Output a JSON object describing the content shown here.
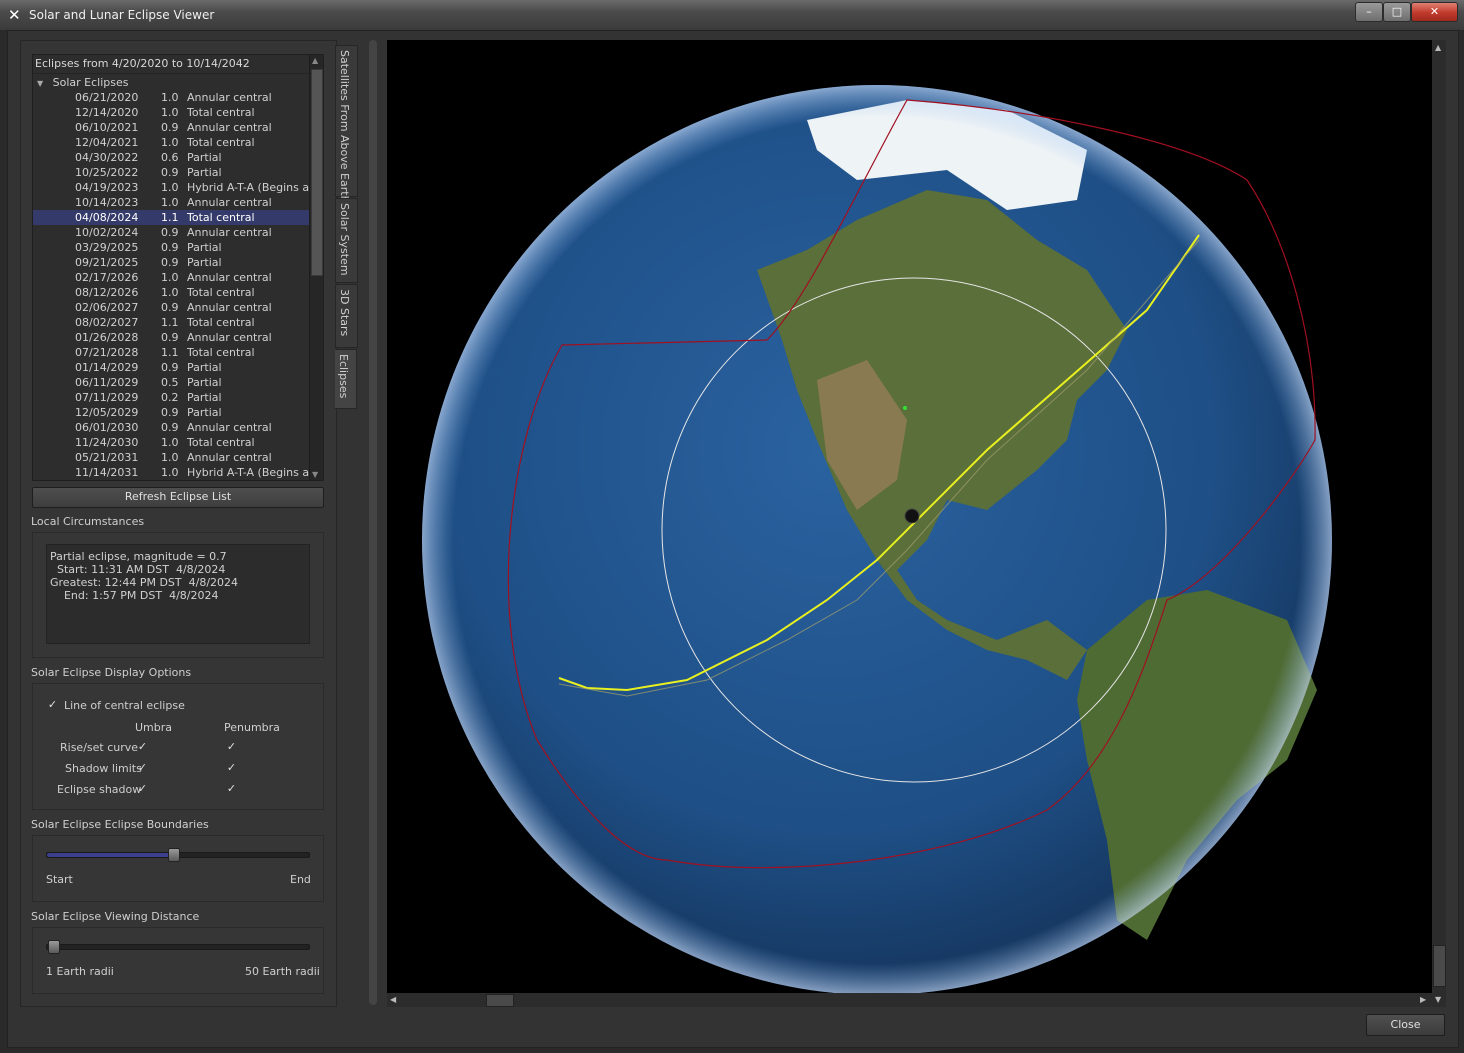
{
  "window": {
    "title": "Solar and Lunar Eclipse Viewer",
    "app_icon": "✕",
    "controls": {
      "minimize": "–",
      "maximize": "□",
      "close": "✕"
    }
  },
  "eclipse_list": {
    "header": "Eclipses from 4/20/2020 to 10/14/2042",
    "group_label": "Solar Eclipses",
    "rows": [
      {
        "date": "06/21/2020",
        "mag": "1.0",
        "type": "Annular central"
      },
      {
        "date": "12/14/2020",
        "mag": "1.0",
        "type": "Total central"
      },
      {
        "date": "06/10/2021",
        "mag": "0.9",
        "type": "Annular central"
      },
      {
        "date": "12/04/2021",
        "mag": "1.0",
        "type": "Total central"
      },
      {
        "date": "04/30/2022",
        "mag": "0.6",
        "type": "Partial"
      },
      {
        "date": "10/25/2022",
        "mag": "0.9",
        "type": "Partial"
      },
      {
        "date": "04/19/2023",
        "mag": "1.0",
        "type": "Hybrid A-T-A (Begins an..."
      },
      {
        "date": "10/14/2023",
        "mag": "1.0",
        "type": "Annular central"
      },
      {
        "date": "04/08/2024",
        "mag": "1.1",
        "type": "Total central"
      },
      {
        "date": "10/02/2024",
        "mag": "0.9",
        "type": "Annular central"
      },
      {
        "date": "03/29/2025",
        "mag": "0.9",
        "type": "Partial"
      },
      {
        "date": "09/21/2025",
        "mag": "0.9",
        "type": "Partial"
      },
      {
        "date": "02/17/2026",
        "mag": "1.0",
        "type": "Annular central"
      },
      {
        "date": "08/12/2026",
        "mag": "1.0",
        "type": "Total central"
      },
      {
        "date": "02/06/2027",
        "mag": "0.9",
        "type": "Annular central"
      },
      {
        "date": "08/02/2027",
        "mag": "1.1",
        "type": "Total central"
      },
      {
        "date": "01/26/2028",
        "mag": "0.9",
        "type": "Annular central"
      },
      {
        "date": "07/21/2028",
        "mag": "1.1",
        "type": "Total central"
      },
      {
        "date": "01/14/2029",
        "mag": "0.9",
        "type": "Partial"
      },
      {
        "date": "06/11/2029",
        "mag": "0.5",
        "type": "Partial"
      },
      {
        "date": "07/11/2029",
        "mag": "0.2",
        "type": "Partial"
      },
      {
        "date": "12/05/2029",
        "mag": "0.9",
        "type": "Partial"
      },
      {
        "date": "06/01/2030",
        "mag": "0.9",
        "type": "Annular central"
      },
      {
        "date": "11/24/2030",
        "mag": "1.0",
        "type": "Total central"
      },
      {
        "date": "05/21/2031",
        "mag": "1.0",
        "type": "Annular central"
      },
      {
        "date": "11/14/2031",
        "mag": "1.0",
        "type": "Hybrid A-T-A (Begins an..."
      }
    ],
    "selected_index": 8
  },
  "side_tabs": [
    "Satellites From Above Earth",
    "Solar System",
    "3D Stars",
    "Eclipses"
  ],
  "refresh_button": "Refresh Eclipse List",
  "local_circumstances": {
    "title": "Local Circumstances",
    "lines": [
      "Partial eclipse, magnitude = 0.7",
      "  Start: 11:31 AM DST  4/8/2024",
      "Greatest: 12:44 PM DST  4/8/2024",
      "    End: 1:57 PM DST  4/8/2024"
    ]
  },
  "display_options": {
    "title": "Solar Eclipse Display Options",
    "central_line": {
      "label": "Line of central eclipse",
      "checked": true
    },
    "col_umbra": "Umbra",
    "col_penumbra": "Penumbra",
    "rows": [
      {
        "label": "Rise/set curve",
        "umbra": true,
        "penumbra": true
      },
      {
        "label": "Shadow limits",
        "umbra": true,
        "penumbra": true
      },
      {
        "label": "Eclipse shadow",
        "umbra": true,
        "penumbra": true
      }
    ],
    "check_glyph": "✓"
  },
  "boundaries": {
    "title": "Solar Eclipse Eclipse Boundaries",
    "start_label": "Start",
    "end_label": "End",
    "value": 0.5
  },
  "viewing_distance": {
    "title": "Solar Eclipse Viewing Distance",
    "min_label": "1 Earth radii",
    "max_label": "50 Earth radii",
    "value": 0.0
  },
  "close_button": "Close",
  "colors": {
    "selection": "#343a6a",
    "central_line": "#e8f020",
    "shadow_limit": "#a01020",
    "ocean": "#1e4f86",
    "land": "#5a6f3a"
  }
}
